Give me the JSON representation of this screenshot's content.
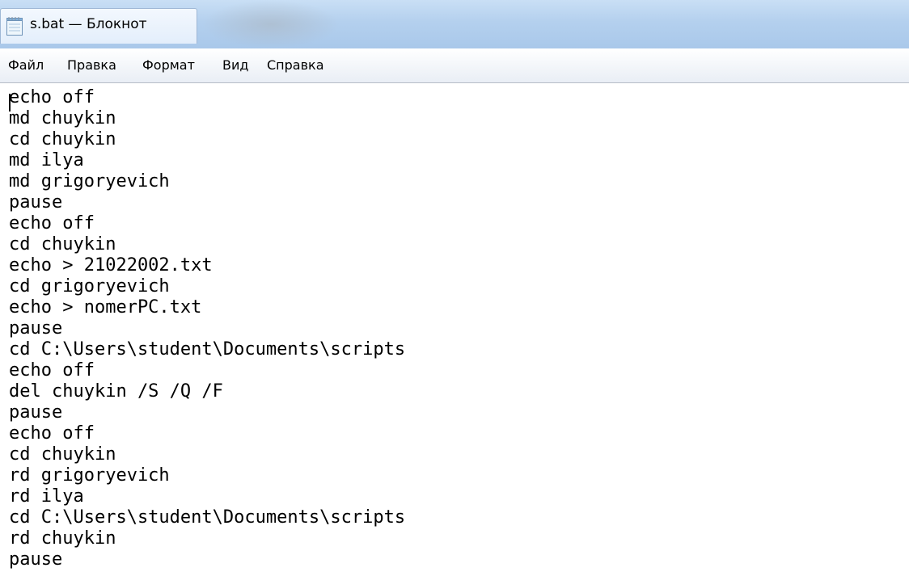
{
  "window": {
    "title": "s.bat — Блокнот",
    "app_icon": "notepad-icon"
  },
  "menu": {
    "items": [
      "Файл",
      "Правка",
      "Формат",
      "Вид",
      "Справка"
    ]
  },
  "editor": {
    "lines": [
      "echo off",
      "md chuykin",
      "cd chuykin",
      "md ilya",
      "md grigoryevich",
      "pause",
      "echo off",
      "cd chuykin",
      "echo > 21022002.txt",
      "cd grigoryevich",
      "echo > nomerPC.txt",
      "pause",
      "cd C:\\Users\\student\\Documents\\scripts",
      "echo off",
      "del chuykin /S /Q /F",
      "pause",
      "echo off",
      "cd chuykin",
      "rd grigoryevich",
      "rd ilya",
      "cd C:\\Users\\student\\Documents\\scripts",
      "rd chuykin",
      "pause"
    ]
  }
}
